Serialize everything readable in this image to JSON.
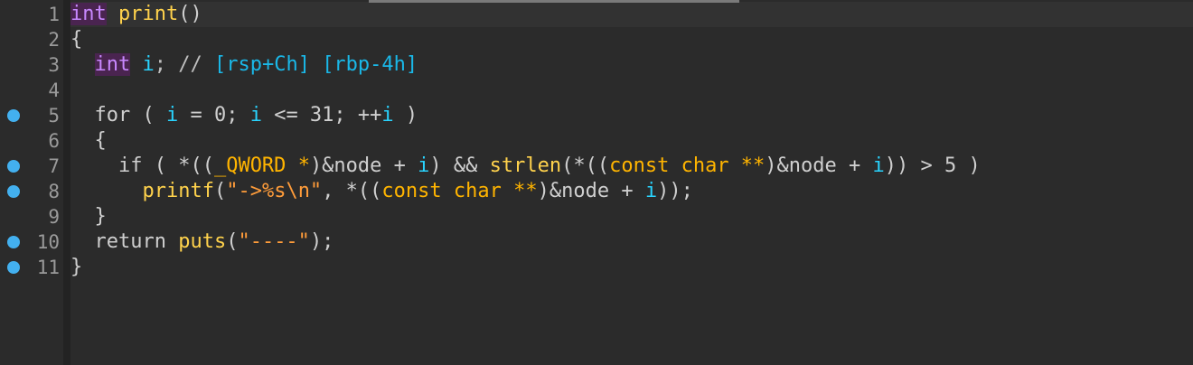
{
  "editor": {
    "line_numbers": [
      "1",
      "2",
      "3",
      "4",
      "5",
      "6",
      "7",
      "8",
      "9",
      "10",
      "11"
    ],
    "breakpoint_lines": [
      5,
      7,
      8,
      10,
      11
    ],
    "lines": [
      [
        {
          "t": "int",
          "c": "ty"
        },
        {
          "t": " ",
          "c": "op"
        },
        {
          "t": "print",
          "c": "fn"
        },
        {
          "t": "()",
          "c": "op"
        }
      ],
      [
        {
          "t": "{",
          "c": "op"
        }
      ],
      [
        {
          "t": "  ",
          "c": "op"
        },
        {
          "t": "int",
          "c": "ty"
        },
        {
          "t": " ",
          "c": "op"
        },
        {
          "t": "i",
          "c": "var"
        },
        {
          "t": "; // ",
          "c": "cmt"
        },
        {
          "t": "[rsp+Ch] [rbp-4h]",
          "c": "cm"
        }
      ],
      [],
      [
        {
          "t": "  for ( ",
          "c": "kw"
        },
        {
          "t": "i",
          "c": "var"
        },
        {
          "t": " = 0; ",
          "c": "op"
        },
        {
          "t": "i",
          "c": "var"
        },
        {
          "t": " <= 31; ++",
          "c": "op"
        },
        {
          "t": "i",
          "c": "var"
        },
        {
          "t": " )",
          "c": "op"
        }
      ],
      [
        {
          "t": "  {",
          "c": "op"
        }
      ],
      [
        {
          "t": "    if ( *((",
          "c": "op"
        },
        {
          "t": "_QWORD",
          "c": "tp"
        },
        {
          "t": " ",
          "c": "op"
        },
        {
          "t": "*",
          "c": "tp"
        },
        {
          "t": ")&node + ",
          "c": "op"
        },
        {
          "t": "i",
          "c": "var"
        },
        {
          "t": ") && ",
          "c": "op"
        },
        {
          "t": "strlen",
          "c": "fn"
        },
        {
          "t": "(*((",
          "c": "op"
        },
        {
          "t": "const char **",
          "c": "tp"
        },
        {
          "t": ")&node + ",
          "c": "op"
        },
        {
          "t": "i",
          "c": "var"
        },
        {
          "t": ")) > 5 )",
          "c": "op"
        }
      ],
      [
        {
          "t": "      ",
          "c": "op"
        },
        {
          "t": "printf",
          "c": "fn"
        },
        {
          "t": "(",
          "c": "op"
        },
        {
          "t": "\"->%s\\n\"",
          "c": "str"
        },
        {
          "t": ", *((",
          "c": "op"
        },
        {
          "t": "const char **",
          "c": "tp"
        },
        {
          "t": ")&node + ",
          "c": "op"
        },
        {
          "t": "i",
          "c": "var"
        },
        {
          "t": "));",
          "c": "op"
        }
      ],
      [
        {
          "t": "  }",
          "c": "op"
        }
      ],
      [
        {
          "t": "  return ",
          "c": "kw"
        },
        {
          "t": "puts",
          "c": "fn"
        },
        {
          "t": "(",
          "c": "op"
        },
        {
          "t": "\"----\"",
          "c": "str"
        },
        {
          "t": ");",
          "c": "op"
        }
      ],
      [
        {
          "t": "}",
          "c": "op"
        }
      ]
    ]
  }
}
